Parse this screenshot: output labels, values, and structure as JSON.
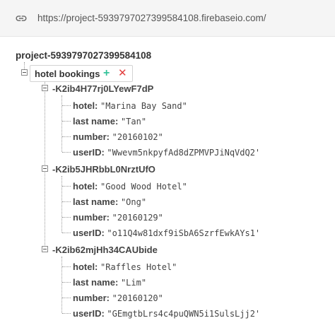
{
  "urlbar": {
    "icon": "link-icon",
    "url": "https://project-5939797027399584108.firebaseio.com/"
  },
  "tree": {
    "root": "project-5939797027399584108",
    "collection": {
      "label": "hotel bookings",
      "add_symbol": "+",
      "delete_symbol": "✕"
    },
    "records": [
      {
        "key": "-K2ib4H77rj0LYewF7dP",
        "fields": [
          {
            "name": "hotel:",
            "value": "\"Marina Bay Sand\""
          },
          {
            "name": "last name:",
            "value": "\"Tan\""
          },
          {
            "name": "number:",
            "value": "\"20160102\""
          },
          {
            "name": "userID:",
            "value": "\"Wwevm5nkpyfAd8dZPMVPJiNqVdQ2'"
          }
        ]
      },
      {
        "key": "-K2ib5JHRbbL0NrztUfO",
        "fields": [
          {
            "name": "hotel:",
            "value": "\"Good Wood Hotel\""
          },
          {
            "name": "last name:",
            "value": "\"Ong\""
          },
          {
            "name": "number:",
            "value": "\"20160129\""
          },
          {
            "name": "userID:",
            "value": "\"o11Q4w81dxf9iSbA6SzrfEwkAYs1'"
          }
        ]
      },
      {
        "key": "-K2ib62mjHh34CAUbide",
        "fields": [
          {
            "name": "hotel:",
            "value": "\"Raffles Hotel\""
          },
          {
            "name": "last name:",
            "value": "\"Lim\""
          },
          {
            "name": "number:",
            "value": "\"20160120\""
          },
          {
            "name": "userID:",
            "value": "\"GEmgtbLrs4c4puQWN5i1SulsLjj2'"
          }
        ]
      }
    ]
  },
  "colors": {
    "add": "#35c39b",
    "delete": "#e23e3e",
    "urlbar_bg": "#f5f5f5"
  }
}
